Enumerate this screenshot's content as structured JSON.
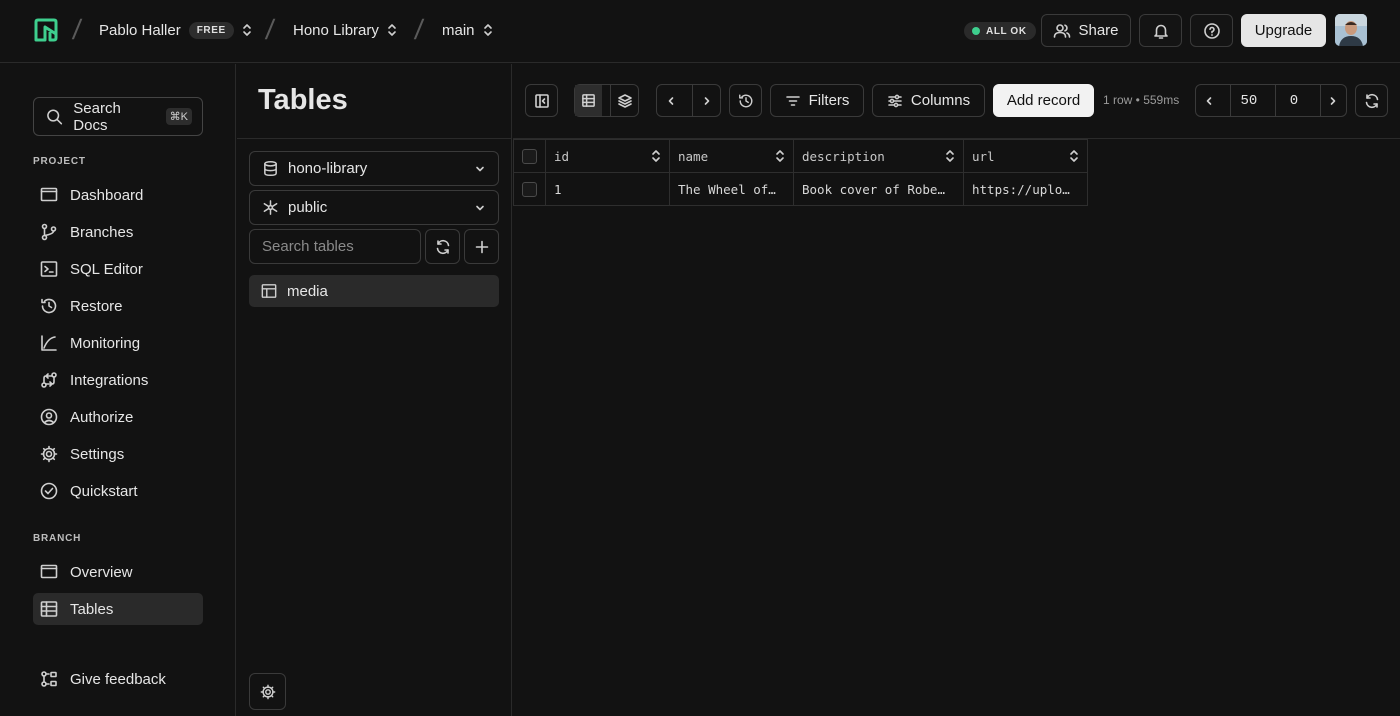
{
  "topbar": {
    "user": "Pablo Haller",
    "plan_badge": "FREE",
    "project": "Hono Library",
    "branch": "main",
    "status": "ALL OK",
    "share_label": "Share",
    "upgrade_label": "Upgrade"
  },
  "sidebar": {
    "search_label": "Search Docs",
    "search_shortcut": "⌘K",
    "project_section": "PROJECT",
    "project_items": [
      {
        "label": "Dashboard",
        "icon": "monitor-icon"
      },
      {
        "label": "Branches",
        "icon": "branch-icon"
      },
      {
        "label": "SQL Editor",
        "icon": "terminal-icon"
      },
      {
        "label": "Restore",
        "icon": "history-icon"
      },
      {
        "label": "Monitoring",
        "icon": "chart-line-icon"
      },
      {
        "label": "Integrations",
        "icon": "integrations-icon"
      },
      {
        "label": "Authorize",
        "icon": "user-circle-icon"
      },
      {
        "label": "Settings",
        "icon": "gear-icon"
      },
      {
        "label": "Quickstart",
        "icon": "check-circle-icon"
      }
    ],
    "branch_section": "BRANCH",
    "branch_items": [
      {
        "label": "Overview",
        "icon": "monitor-icon"
      },
      {
        "label": "Tables",
        "icon": "table-icon"
      }
    ],
    "feedback_label": "Give feedback"
  },
  "tables_panel": {
    "title": "Tables",
    "database": "hono-library",
    "schema": "public",
    "search_placeholder": "Search tables",
    "tables": [
      "media"
    ]
  },
  "toolbar": {
    "filters_label": "Filters",
    "columns_label": "Columns",
    "add_record_label": "Add record",
    "meta": "1 row • 559ms",
    "page_size": "50",
    "offset": "0"
  },
  "grid": {
    "columns": [
      "id",
      "name",
      "description",
      "url"
    ],
    "rows": [
      [
        "1",
        "The Wheel of…",
        "Book cover of Robe…",
        "https://uplo…"
      ]
    ]
  },
  "colors": {
    "accent": "#3ecf8e",
    "background": "#121212",
    "border": "#2a2a2a"
  }
}
